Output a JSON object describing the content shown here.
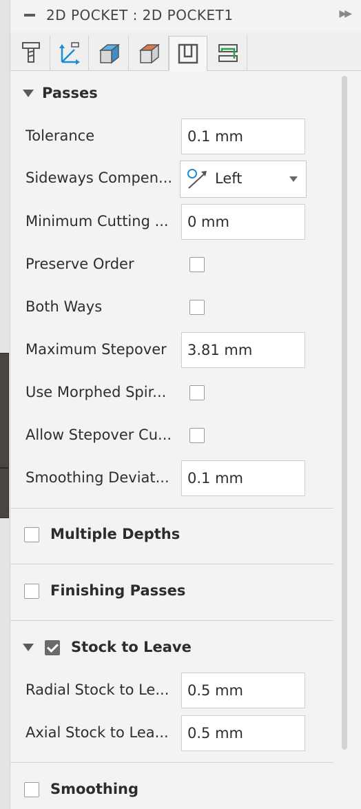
{
  "panel": {
    "title": "2D POCKET : 2D POCKET1",
    "tabs": [
      {
        "name": "tool"
      },
      {
        "name": "geometry"
      },
      {
        "name": "heights"
      },
      {
        "name": "stock"
      },
      {
        "name": "passes"
      },
      {
        "name": "linking"
      }
    ],
    "active_tab": 4
  },
  "passes": {
    "title": "Passes",
    "expanded": true,
    "tolerance": {
      "label": "Tolerance",
      "value": "0.1 mm"
    },
    "sideways": {
      "label": "Sideways Compen...",
      "value": "Left",
      "icon": "compensation-left-icon"
    },
    "min_cutting": {
      "label": "Minimum Cutting ...",
      "value": "0 mm"
    },
    "preserve_order": {
      "label": "Preserve Order",
      "checked": false
    },
    "both_ways": {
      "label": "Both Ways",
      "checked": false
    },
    "max_stepover": {
      "label": "Maximum Stepover",
      "value": "3.81 mm"
    },
    "morphed_spiral": {
      "label": "Use Morphed Spir...",
      "checked": false
    },
    "allow_stepover": {
      "label": "Allow Stepover Cu...",
      "checked": false
    },
    "smoothing_dev": {
      "label": "Smoothing Deviat...",
      "value": "0.1 mm"
    }
  },
  "multiple_depths": {
    "title": "Multiple Depths",
    "checked": false
  },
  "finishing_passes": {
    "title": "Finishing Passes",
    "checked": false
  },
  "stock_to_leave": {
    "title": "Stock to Leave",
    "checked": true,
    "radial": {
      "label": "Radial Stock to Le...",
      "value": "0.5 mm"
    },
    "axial": {
      "label": "Axial Stock to Lea...",
      "value": "0.5 mm"
    }
  },
  "smoothing": {
    "title": "Smoothing",
    "checked": false
  },
  "colors": {
    "accent_blue": "#1a8fd0",
    "stock_orange": "#d9784a",
    "panel_bg": "#f3f3f3"
  }
}
